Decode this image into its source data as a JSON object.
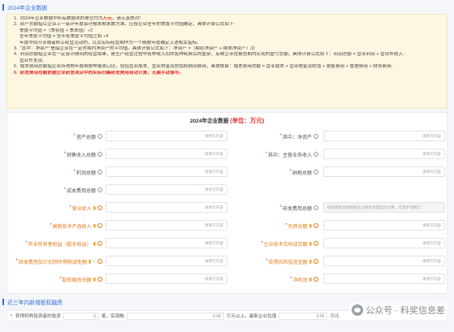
{
  "section1": {
    "title": "2024年企业数据"
  },
  "notice": {
    "items": [
      {
        "num": "1.",
        "text_a": "2024年企业数据中所有数据项的单位均为",
        "text_red": "万元",
        "text_b": "，请认真核对!"
      },
      {
        "num": "2.",
        "text": "资产总额指以企业上一会计年度会计报表期末数为准，应按企业全年的季度平均值确定，具体计算公式如下:"
      },
      {
        "ind": true,
        "text": "季度平均值 =（季初值 + 季末值）÷2"
      },
      {
        "ind": true,
        "text": "全年季度平均值 = 全年各季度平均值之和 ÷4"
      },
      {
        "ind": true,
        "text": "年度中间开业或者终止经营活动的，以其实际经营期作为一个纳税年度确定上述相关指标。"
      },
      {
        "num": "3.",
        "text": "\"其中：净资产\"是指企业在一定时期内净资产的平均值。具体计算公式如下：净资产 =（期初净资产 + 期末净资产）/2;"
      },
      {
        "num": "4.",
        "text": "利润总额指企业在一定会计期间的经营成果，是生产经营过程中各种收入扣除各种耗费后的盈余，反映企业在报告期内实现的盈亏总额。具体计算公式如下：利润总额 = 营业利润 + 营业外收入 -"
      },
      {
        "ind": true,
        "text": "营业外支出;"
      },
      {
        "num": "5.",
        "text": "成本费用总额指企业所得税年度纳税申报表口径，包括营业成本、营业税金及附加和期间费用，具体核算：成本费用总额 = 营业成本 + 营业税金及附加 + 销售费用 + 管理费用 + 财务费用;"
      },
      {
        "num": "6.",
        "red": true,
        "text": "研发费用总额依据企业研发项目中的实际归集研发费用自动计算，无需手动填写。"
      }
    ]
  },
  "form": {
    "title": "2024年企业数据",
    "unit": "(单位：万元)",
    "placeholder": "请填写内容",
    "rd_auto_text": "研发费用总额根据企业研发项目自动计算，无需手动填写",
    "rows": [
      [
        {
          "label": "资产总额",
          "req": true
        },
        {
          "label": "其中：净资产",
          "req": true
        }
      ],
      [
        {
          "label": "销售收入总额",
          "req": true
        },
        {
          "label": "其中：主营业务收入",
          "req": true
        }
      ],
      [
        {
          "label": "利润总额",
          "req": true
        },
        {
          "label": "纳税总额",
          "req": true
        }
      ],
      [
        {
          "label": "成本费用总额",
          "req": true
        },
        {
          "empty": true
        }
      ],
      [
        {
          "label": "营业收入",
          "req": true,
          "orange": true,
          "book": true
        },
        {
          "label": "研发费用总额",
          "req": true,
          "disabled": true
        }
      ],
      [
        {
          "label": "高新技术产品收入",
          "req": true,
          "orange": true,
          "book": true
        },
        {
          "label": "负债总额",
          "req": true,
          "orange": true,
          "book": true
        }
      ],
      [
        {
          "label": "年末所有者权益（股东权益）",
          "req": true,
          "orange": true,
          "book": true
        },
        {
          "label": "企业技术合同成交额",
          "req": true,
          "orange": true,
          "book": true
        }
      ],
      [
        {
          "label": "研发费用加计扣除所得税减免额",
          "req": true,
          "orange": true,
          "book": true,
          "hand": true
        },
        {
          "label": "获得风险投资金额",
          "req": true,
          "orange": true,
          "book": true
        }
      ],
      [
        {
          "label": "股权融资总额",
          "req": true,
          "orange": true,
          "book": true
        },
        {
          "label": "净利润",
          "req": true,
          "orange": true,
          "book": true
        }
      ]
    ]
  },
  "section2": {
    "title": "近三年内新增股权融资"
  },
  "bottom": {
    "label": "获得机构投资者的投资",
    "val1": "0",
    "text1": "笔，实现融",
    "val2": "0.00",
    "text2": "万元以上，最新企业估值",
    "val3": "0.00",
    "text3": "万元"
  },
  "watermark": {
    "text": "公众号 · 科奖信息差"
  }
}
